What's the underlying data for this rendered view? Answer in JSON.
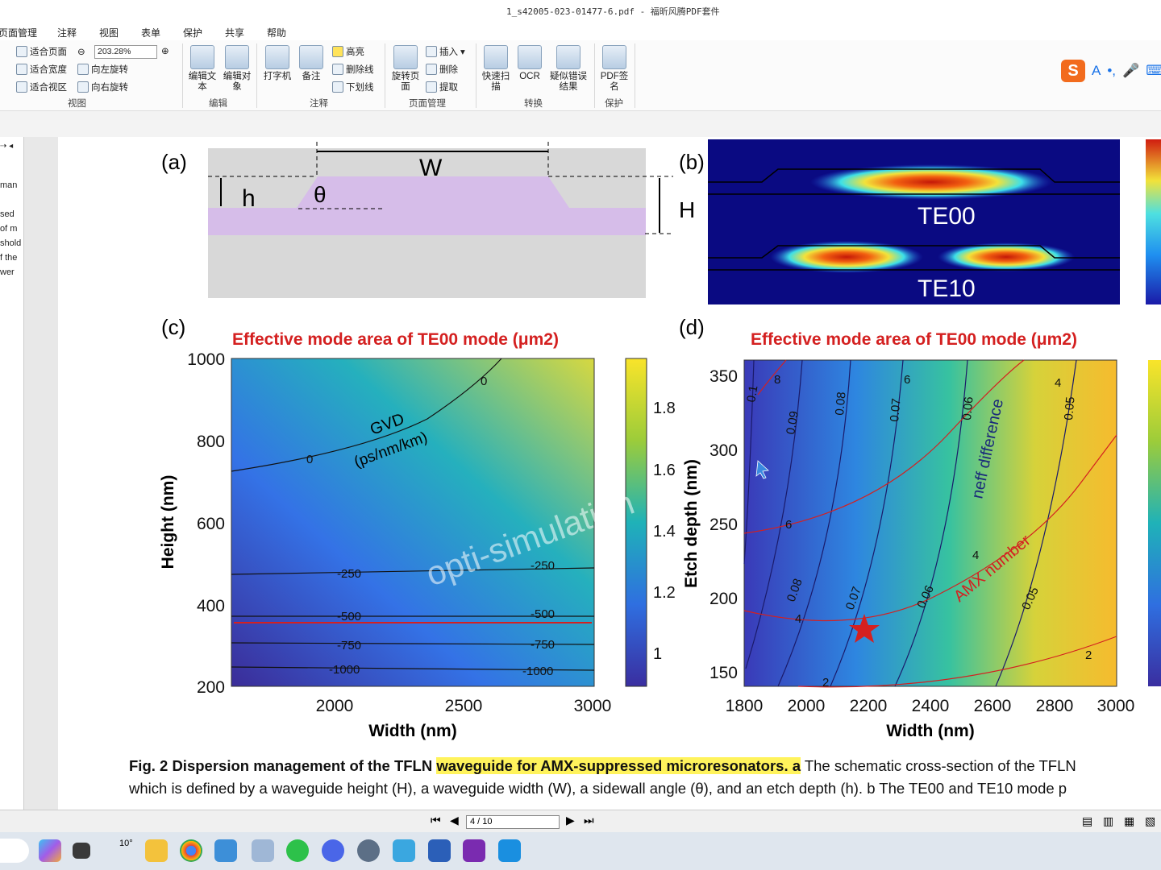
{
  "window": {
    "title": "1_s42005-023-01477-6.pdf - 福昕风腾PDF套件"
  },
  "menu": [
    "页面管理",
    "注释",
    "视图",
    "表单",
    "保护",
    "共享",
    "帮助"
  ],
  "ribbon": {
    "view": {
      "fit_page": "适合页面",
      "fit_width": "适合宽度",
      "fit_visible": "适合视区",
      "zoom_value": "203.28%",
      "rotate_left": "向左旋转",
      "rotate_right": "向右旋转",
      "label": "视图"
    },
    "edit": {
      "edit_text": "编辑文本",
      "edit_object": "编辑对象",
      "label": "编辑"
    },
    "annot": {
      "typewriter": "打字机",
      "note": "备注",
      "highlight": "高亮",
      "strikeout": "删除线",
      "underline": "下划线",
      "label": "注释"
    },
    "pages": {
      "rotate_page": "旋转页面",
      "insert": "插入",
      "delete": "删除",
      "extract": "提取",
      "label": "页面管理"
    },
    "convert": {
      "quick_scan": "快速扫描",
      "ocr": "OCR",
      "suspect": "疑似错误结果",
      "label": "转换"
    },
    "protect": {
      "sign": "PDF签名",
      "label": "保护"
    }
  },
  "left_panel_snippets": [
    "man",
    "sed",
    "of m",
    "shold",
    "f the",
    "wer"
  ],
  "figure": {
    "a": {
      "label": "(a)",
      "W": "W",
      "h": "h",
      "theta": "θ",
      "H": "H"
    },
    "b": {
      "label": "(b)",
      "te00": "TE00",
      "te10": "TE10"
    },
    "c": {
      "label": "(c)",
      "title": "Effective mode area of TE00 mode (μm2)",
      "xlabel": "Width (nm)",
      "ylabel": "Height (nm)",
      "xticks": [
        "2000",
        "2500",
        "3000"
      ],
      "yticks": [
        "1000",
        "800",
        "600",
        "400",
        "200"
      ],
      "cbticks": [
        "1.8",
        "1.6",
        "1.4",
        "1.2",
        "1"
      ],
      "gvd_label": "GVD",
      "gvd_unit": "(ps/nm/km)",
      "contours": [
        "0",
        "0",
        "-250",
        "-250",
        "-500",
        "-500",
        "-750",
        "-750",
        "-1000",
        "-1000"
      ]
    },
    "d": {
      "label": "(d)",
      "title": "Effective mode area of TE00 mode (μm2)",
      "xlabel": "Width (nm)",
      "ylabel": "Etch depth (nm)",
      "xticks": [
        "1800",
        "2000",
        "2200",
        "2400",
        "2600",
        "2800",
        "3000"
      ],
      "yticks": [
        "350",
        "300",
        "250",
        "200",
        "150"
      ],
      "neff_label": "neff difference",
      "amx_label": "AMX number",
      "blue_contours": [
        "0.1",
        "0.09",
        "0.08",
        "0.07",
        "0.06",
        "0.05",
        "0.08",
        "0.07",
        "0.06",
        "0.05"
      ],
      "red_contours": [
        "8",
        "6",
        "4",
        "6",
        "4",
        "4",
        "2",
        "2"
      ]
    },
    "watermark": "opti-simulation"
  },
  "caption": {
    "line1_bold": "Fig. 2 Dispersion management of the TFLN ",
    "line1_bold_hl": "waveguide for AMX-suppressed microresonators. a",
    "line1_rest": " The schematic cross-section of the TFLN",
    "line2": "which is defined by a waveguide height (H), a waveguide width (W), a sidewall angle (θ), and an etch depth (h). b The TE00 and TE10 mode p"
  },
  "status": {
    "page_indicator": "4 / 10"
  },
  "taskbar": {
    "weather": "10°"
  },
  "colors": {
    "accent": "#1a73e8",
    "highlight": "#fff35c",
    "red": "#d42020"
  }
}
